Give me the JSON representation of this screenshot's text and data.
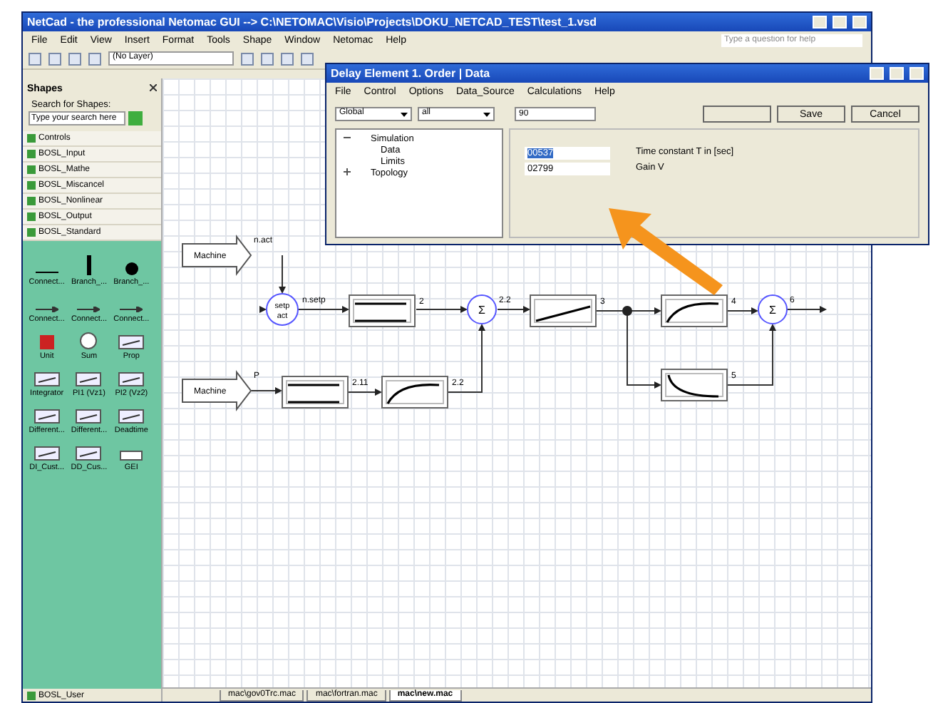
{
  "window": {
    "title": "NetCad  -  the professional  Netomac  GUI  --> C:\\NETOMAC\\Visio\\Projects\\DOKU_NETCAD_TEST\\test_1.vsd"
  },
  "menu": [
    "File",
    "Edit",
    "View",
    "Insert",
    "Format",
    "Tools",
    "Shape",
    "Window",
    "Netomac",
    "Help"
  ],
  "help_field": {
    "placeholder": "Type a question for help"
  },
  "toolbar": {
    "layer": "(No Layer)"
  },
  "shapes_panel": {
    "title": "Shapes",
    "search_label": "Search for Shapes:",
    "search": {
      "placeholder": "Type your search here"
    },
    "stencils": [
      "Controls",
      "BOSL_Input",
      "BOSL_Mathe",
      "BOSL_Miscancel",
      "BOSL_Nonlinear",
      "BOSL_Output",
      "BOSL_Standard"
    ],
    "shapes": [
      {
        "kind": "line",
        "label": "Connect..."
      },
      {
        "kind": "bar",
        "label": "Branch_..."
      },
      {
        "kind": "dot",
        "label": "Branch_..."
      },
      {
        "kind": "arrow",
        "label": "Connect..."
      },
      {
        "kind": "arrow",
        "label": "Connect..."
      },
      {
        "kind": "arrow",
        "label": "Connect..."
      },
      {
        "kind": "unit",
        "label": "Unit"
      },
      {
        "kind": "sum",
        "label": "Sum"
      },
      {
        "kind": "block",
        "label": "Prop"
      },
      {
        "kind": "block",
        "label": "Integrator"
      },
      {
        "kind": "block",
        "label": "PI1 (Vz1)"
      },
      {
        "kind": "block",
        "label": "PI2 (Vz2)"
      },
      {
        "kind": "block",
        "label": "Different..."
      },
      {
        "kind": "block",
        "label": "Different..."
      },
      {
        "kind": "block",
        "label": "Deadtime"
      },
      {
        "kind": "block",
        "label": "DI_Cust..."
      },
      {
        "kind": "block",
        "label": "DD_Cus..."
      },
      {
        "kind": "small",
        "label": "GEI"
      }
    ],
    "footer_stencil": "BOSL_User"
  },
  "diagram": {
    "nodes": [
      {
        "kind": "source",
        "label": "Machine",
        "output": "n.act"
      },
      {
        "kind": "setpoint",
        "lines": [
          "setp",
          "act"
        ],
        "output": "n.setp"
      },
      {
        "kind": "step",
        "output": "2"
      },
      {
        "kind": "sum",
        "label": "Σ",
        "output": "2.2"
      },
      {
        "kind": "ramp",
        "output": "3"
      },
      {
        "kind": "junction"
      },
      {
        "kind": "rise",
        "output": "4"
      },
      {
        "kind": "sum",
        "label": "Σ",
        "output": "6"
      },
      {
        "kind": "decay",
        "output": "5"
      },
      {
        "kind": "source",
        "label": "Machine",
        "output": "P"
      },
      {
        "kind": "step",
        "output": "2.11"
      },
      {
        "kind": "rise",
        "output": "2.2"
      }
    ]
  },
  "page_tabs": [
    {
      "label": "mac\\gov0Trc.mac",
      "selected": false
    },
    {
      "label": "mac\\fortran.mac",
      "selected": false
    },
    {
      "label": "mac\\new.mac",
      "selected": true
    }
  ],
  "dialog": {
    "title": "Delay Element 1. Order   |   Data",
    "menu": [
      "File",
      "Control",
      "Options",
      "Data_Source",
      "Calculations",
      "Help"
    ],
    "combos": [
      "Global",
      "all"
    ],
    "field": "90",
    "buttons": [
      {
        "kind": "blank"
      },
      {
        "kind": "text",
        "label": "Save"
      },
      {
        "kind": "text",
        "label": "Cancel"
      }
    ],
    "tree": [
      {
        "label": "Simulation",
        "expanded": true,
        "children": [
          {
            "label": "Data"
          },
          {
            "label": "Limits"
          }
        ]
      },
      {
        "label": "Topology",
        "expanded": false
      }
    ],
    "params": [
      {
        "value": "00537",
        "highlighted": true,
        "label": "Time constant T in [sec]"
      },
      {
        "value": "02799",
        "highlighted": false,
        "label": "Gain V"
      }
    ]
  }
}
